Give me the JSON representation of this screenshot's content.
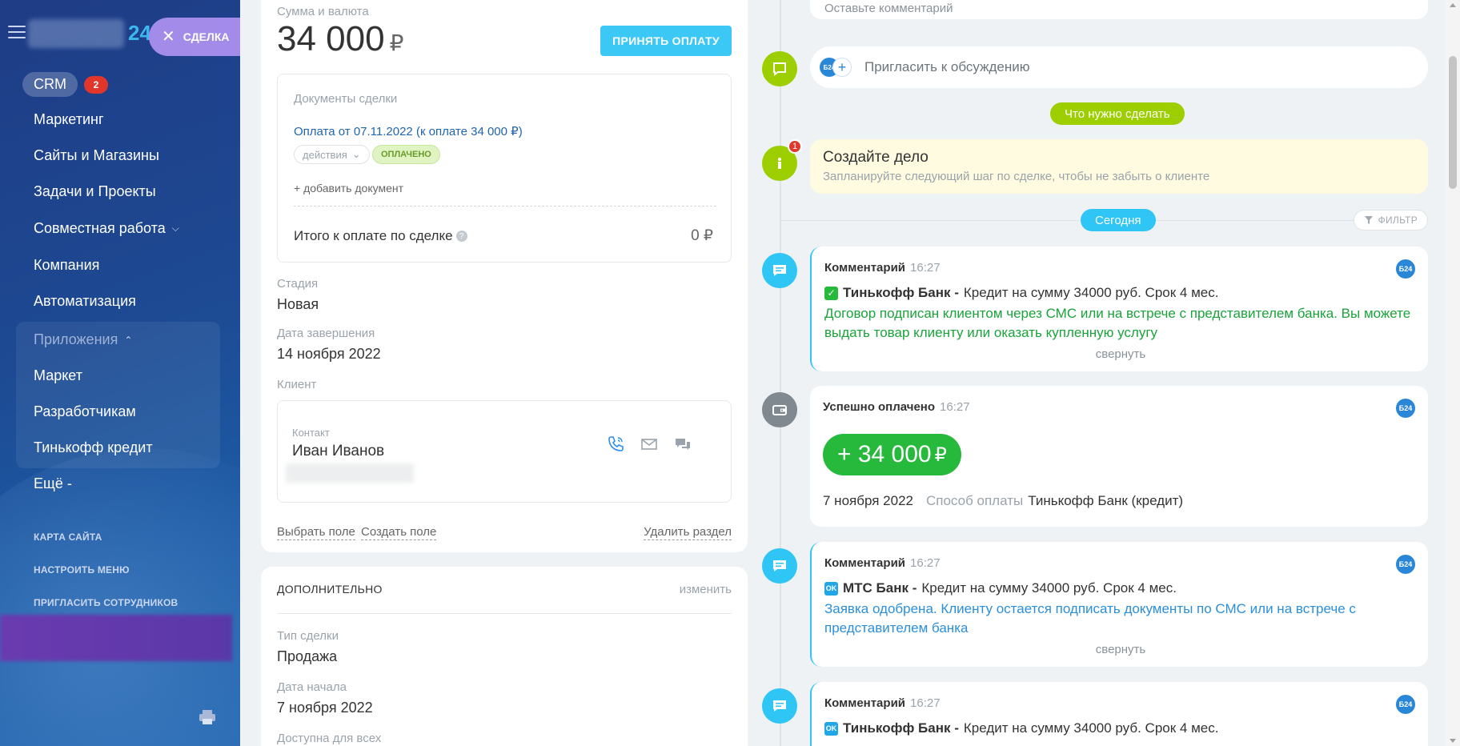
{
  "sidebar": {
    "logo_suffix": "24",
    "deal_tab": "СДЕЛКА",
    "crm_label": "CRM",
    "crm_badge": "2",
    "items": [
      {
        "label": "Маркетинг"
      },
      {
        "label": "Сайты и Магазины"
      },
      {
        "label": "Задачи и Проекты"
      },
      {
        "label": "Совместная работа"
      },
      {
        "label": "Компания"
      },
      {
        "label": "Автоматизация"
      },
      {
        "label": "Приложения"
      },
      {
        "label": "Маркет"
      },
      {
        "label": "Разработчикам"
      },
      {
        "label": "Тинькофф кредит"
      },
      {
        "label": "Ещё -"
      }
    ],
    "footer_links": [
      "КАРТА САЙТА",
      "НАСТРОИТЬ МЕНЮ",
      "ПРИГЛАСИТЬ СОТРУДНИКОВ"
    ]
  },
  "deal": {
    "amount_label": "Сумма и валюта",
    "amount": "34 000",
    "currency": "₽",
    "pay_button": "ПРИНЯТЬ ОПЛАТУ",
    "docs_title": "Документы сделки",
    "doc_link": "Оплата от 07.11.2022 (к оплате 34 000 ₽)",
    "actions_label": "действия",
    "paid_badge": "ОПЛАЧЕНО",
    "add_doc": "+ добавить документ",
    "total_label": "Итого к оплате по сделке",
    "total_value": "0 ₽",
    "stage_label": "Стадия",
    "stage_value": "Новая",
    "close_date_label": "Дата завершения",
    "close_date_value": "14 ноября 2022",
    "client_label": "Клиент",
    "contact_label": "Контакт",
    "contact_name": "Иван Иванов",
    "select_field": "Выбрать поле",
    "create_field": "Создать поле",
    "delete_section": "Удалить раздел"
  },
  "extra": {
    "title": "ДОПОЛНИТЕЛЬНО",
    "change": "изменить",
    "type_label": "Тип сделки",
    "type_value": "Продажа",
    "start_label": "Дата начала",
    "start_value": "7 ноября 2022",
    "access_label": "Доступна для всех"
  },
  "timeline": {
    "comment_placeholder": "Оставьте комментарий",
    "invite": "Пригласить к обсуждению",
    "todo_pill": "Что нужно сделать",
    "task_badge": "1",
    "task_title": "Создайте дело",
    "task_sub": "Запланируйте следующий шаг по сделке, чтобы не забыть о клиенте",
    "today_pill": "Сегодня",
    "filter": "ФИЛЬТР",
    "b24": "Б24",
    "events": [
      {
        "type": "Комментарий",
        "time": "16:27",
        "bank": "Тинькофф Банк -",
        "text": "Кредит на сумму 34000 руб. Срок 4 мес.",
        "message": "Договор подписан клиентом через СМС или на встрече с представителем банка. Вы можете выдать товар клиенту или оказать купленную услугу",
        "collapse": "свернуть"
      },
      {
        "type": "Успешно оплачено",
        "time": "16:27",
        "amount": "+ 34 000",
        "currency": "₽",
        "date": "7 ноября 2022",
        "method_label": "Способ оплаты",
        "method_value": "Тинькофф Банк (кредит)"
      },
      {
        "type": "Комментарий",
        "time": "16:27",
        "bank": "МТС Банк -",
        "text": "Кредит на сумму 34000 руб. Срок 4 мес.",
        "message": "Заявка одобрена. Клиенту остается подписать документы по СМС или на встрече с представителем банка",
        "collapse": "свернуть"
      },
      {
        "type": "Комментарий",
        "time": "16:27",
        "bank": "Тинькофф Банк -",
        "text": "Кредит на сумму 34000 руб. Срок 4 мес."
      }
    ]
  },
  "colors": {
    "accent_blue": "#3bc8f5",
    "green": "#9dcf00",
    "success": "#27b93b",
    "link": "#2066b0",
    "deal_tab": "#a38bea"
  }
}
